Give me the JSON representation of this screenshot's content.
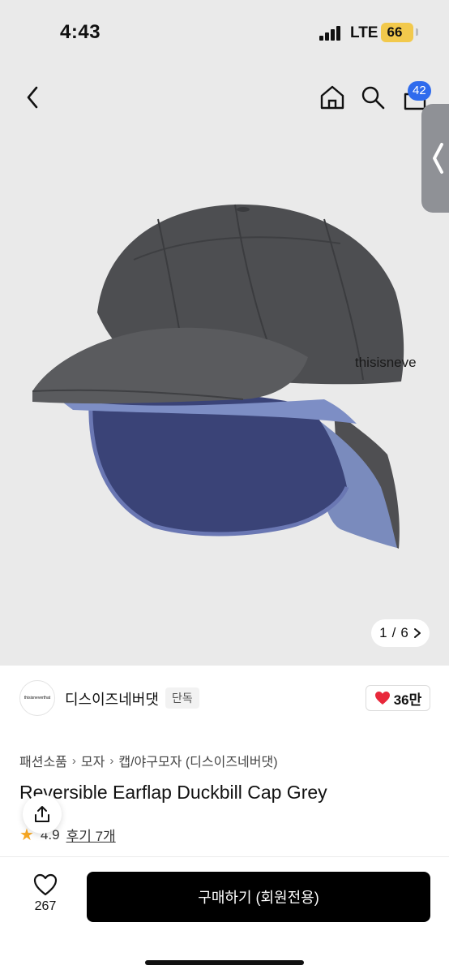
{
  "status_bar": {
    "time": "4:43",
    "network": "LTE",
    "battery": "66"
  },
  "header": {
    "back_icon": "chevron-left-icon",
    "home_icon": "home-icon",
    "search_icon": "search-icon",
    "cart_icon": "cart-icon",
    "cart_badge": "42"
  },
  "gallery": {
    "current": "1",
    "separator": "/",
    "total": "6",
    "next_icon": "chevron-right-icon",
    "side_handle_icon": "chevron-left-icon",
    "cap_brand_print": "thisisneve"
  },
  "brand": {
    "logo_text": "thisisneverthat",
    "name": "디스이즈네버댓",
    "tag": "단독",
    "likes": "36만"
  },
  "breadcrumb": {
    "items": [
      "패션소품",
      "모자",
      "캡/야구모자 (디스이즈네버댓)"
    ]
  },
  "product": {
    "title": "Reversible Earflap Duckbill Cap Grey",
    "rating": "4.9",
    "reviews": "후기 7개"
  },
  "bottom_bar": {
    "wish_count": "267",
    "buy_label": "구매하기 (회원전용)"
  },
  "colors": {
    "accent_blue": "#2f6bed",
    "battery_yellow": "#f2c94c",
    "heart_red": "#e8283b",
    "star_orange": "#f5a623",
    "buy_button": "#000000"
  }
}
